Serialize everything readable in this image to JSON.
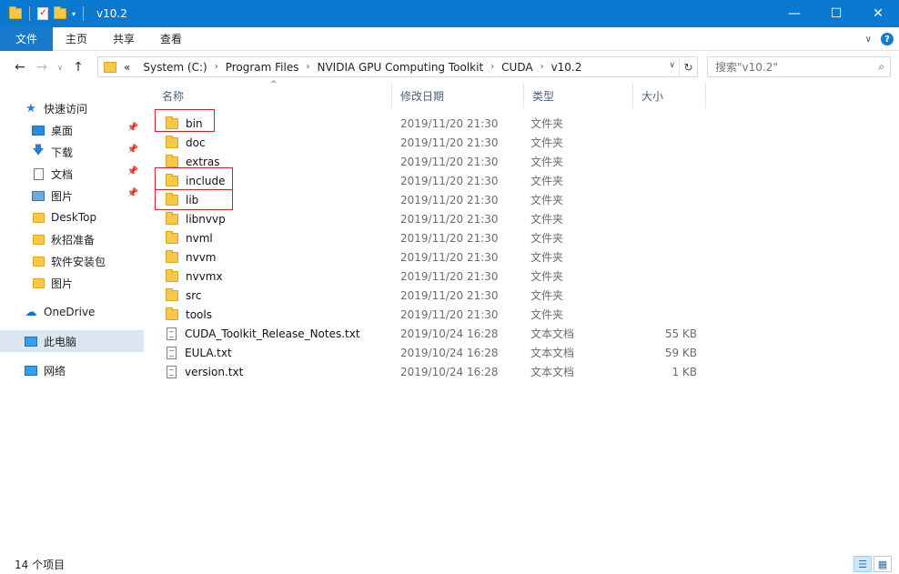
{
  "window": {
    "title": "v10.2",
    "controls": {
      "minimize": "—",
      "maximize": "☐",
      "close": "✕"
    }
  },
  "ribbon": {
    "tabs": [
      "文件",
      "主页",
      "共享",
      "查看"
    ]
  },
  "address": {
    "overflow": "«",
    "crumbs": [
      "System (C:)",
      "Program Files",
      "NVIDIA GPU Computing Toolkit",
      "CUDA",
      "v10.2"
    ]
  },
  "search": {
    "placeholder": "搜索\"v10.2\""
  },
  "navpane": {
    "items": [
      {
        "label": "快速访问",
        "icon": "star-icon",
        "pinned": false
      },
      {
        "label": "桌面",
        "icon": "desktop-icon",
        "pinned": true
      },
      {
        "label": "下载",
        "icon": "download-icon",
        "pinned": true
      },
      {
        "label": "文档",
        "icon": "document-icon",
        "pinned": true
      },
      {
        "label": "图片",
        "icon": "pictures-icon",
        "pinned": true
      },
      {
        "label": "DeskTop",
        "icon": "folder-icon",
        "pinned": false
      },
      {
        "label": "秋招准备",
        "icon": "folder-icon",
        "pinned": false
      },
      {
        "label": "软件安装包",
        "icon": "folder-icon",
        "pinned": false
      },
      {
        "label": "图片",
        "icon": "folder-icon",
        "pinned": false
      },
      {
        "label": "OneDrive",
        "icon": "cloud-icon",
        "pinned": false
      },
      {
        "label": "此电脑",
        "icon": "computer-icon",
        "pinned": false
      },
      {
        "label": "网络",
        "icon": "network-icon",
        "pinned": false
      }
    ]
  },
  "columns": {
    "name": "名称",
    "date": "修改日期",
    "type": "类型",
    "size": "大小"
  },
  "files": [
    {
      "name": "bin",
      "date": "2019/11/20 21:30",
      "type": "文件夹",
      "size": "",
      "kind": "folder",
      "highlighted": true
    },
    {
      "name": "doc",
      "date": "2019/11/20 21:30",
      "type": "文件夹",
      "size": "",
      "kind": "folder",
      "highlighted": false
    },
    {
      "name": "extras",
      "date": "2019/11/20 21:30",
      "type": "文件夹",
      "size": "",
      "kind": "folder",
      "highlighted": false
    },
    {
      "name": "include",
      "date": "2019/11/20 21:30",
      "type": "文件夹",
      "size": "",
      "kind": "folder",
      "highlighted": true
    },
    {
      "name": "lib",
      "date": "2019/11/20 21:30",
      "type": "文件夹",
      "size": "",
      "kind": "folder",
      "highlighted": true
    },
    {
      "name": "libnvvp",
      "date": "2019/11/20 21:30",
      "type": "文件夹",
      "size": "",
      "kind": "folder",
      "highlighted": false
    },
    {
      "name": "nvml",
      "date": "2019/11/20 21:30",
      "type": "文件夹",
      "size": "",
      "kind": "folder",
      "highlighted": false
    },
    {
      "name": "nvvm",
      "date": "2019/11/20 21:30",
      "type": "文件夹",
      "size": "",
      "kind": "folder",
      "highlighted": false
    },
    {
      "name": "nvvmx",
      "date": "2019/11/20 21:30",
      "type": "文件夹",
      "size": "",
      "kind": "folder",
      "highlighted": false
    },
    {
      "name": "src",
      "date": "2019/11/20 21:30",
      "type": "文件夹",
      "size": "",
      "kind": "folder",
      "highlighted": false
    },
    {
      "name": "tools",
      "date": "2019/11/20 21:30",
      "type": "文件夹",
      "size": "",
      "kind": "folder",
      "highlighted": false
    },
    {
      "name": "CUDA_Toolkit_Release_Notes.txt",
      "date": "2019/10/24 16:28",
      "type": "文本文档",
      "size": "55 KB",
      "kind": "file",
      "highlighted": false
    },
    {
      "name": "EULA.txt",
      "date": "2019/10/24 16:28",
      "type": "文本文档",
      "size": "59 KB",
      "kind": "file",
      "highlighted": false
    },
    {
      "name": "version.txt",
      "date": "2019/10/24 16:28",
      "type": "文本文档",
      "size": "1 KB",
      "kind": "file",
      "highlighted": false
    }
  ],
  "status": {
    "count": "14 个项目"
  },
  "colors": {
    "titlebar": "#0b79d0",
    "file_tab": "#1979ca",
    "selected_nav": "#dbe6f1",
    "annotation": "#d81e2c"
  }
}
